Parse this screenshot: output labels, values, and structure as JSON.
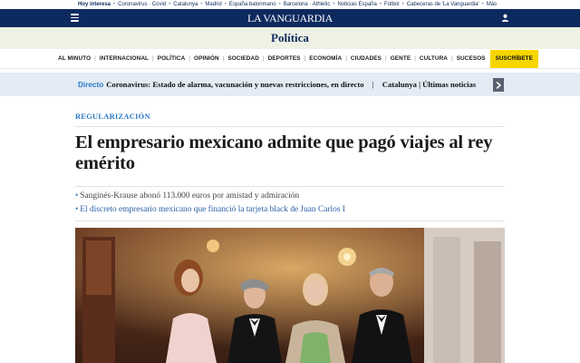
{
  "topbar": {
    "items": [
      {
        "label": "Hoy interesa"
      },
      {
        "label": "Coronavirus · Covid"
      },
      {
        "label": "Catalunya"
      },
      {
        "label": "Madrid"
      },
      {
        "label": "España balonmano"
      },
      {
        "label": "Barcelona · Athletic"
      },
      {
        "label": "Noticias España"
      },
      {
        "label": "Fútbol"
      },
      {
        "label": "Cabeceras de 'La Vanguardia'"
      },
      {
        "label": "Más"
      }
    ]
  },
  "masthead": {
    "logo": "LA VANGUARDIA",
    "menu_icon": "hamburger-menu-icon",
    "user_icon": "user-icon",
    "bg_color": "#0d2a5e"
  },
  "section": {
    "title": "Política"
  },
  "nav": {
    "items": [
      {
        "label": "AL MINUTO"
      },
      {
        "label": "INTERNACIONAL"
      },
      {
        "label": "POLÍTICA"
      },
      {
        "label": "OPINIÓN"
      },
      {
        "label": "SOCIEDAD"
      },
      {
        "label": "DEPORTES"
      },
      {
        "label": "ECONOMÍA"
      },
      {
        "label": "CIUDADES"
      },
      {
        "label": "GENTE"
      },
      {
        "label": "CULTURA"
      },
      {
        "label": "SUCESOS"
      }
    ],
    "subscribe_label": "SUSCRÍBETE",
    "subscribe_color": "#f6d600"
  },
  "ticker": {
    "label": "Directo",
    "headline": "Coronavirus: Estado de alarma, vacunación y nuevas restricciones, en directo",
    "next": "Catalunya | Últimas noticias",
    "next_icon": "chevron-right-icon"
  },
  "article": {
    "kicker": "REGULARIZACIÓN",
    "headline": "El empresario mexicano admite que pagó viajes al rey emérito",
    "related": [
      {
        "text": "Sanginés-Krause abonó 113.000 euros por amistad y admiración"
      },
      {
        "text": "El discreto empresario mexicano que financió la tarjeta black de Juan Carlos I"
      }
    ],
    "accent_color": "#2a79c7"
  }
}
